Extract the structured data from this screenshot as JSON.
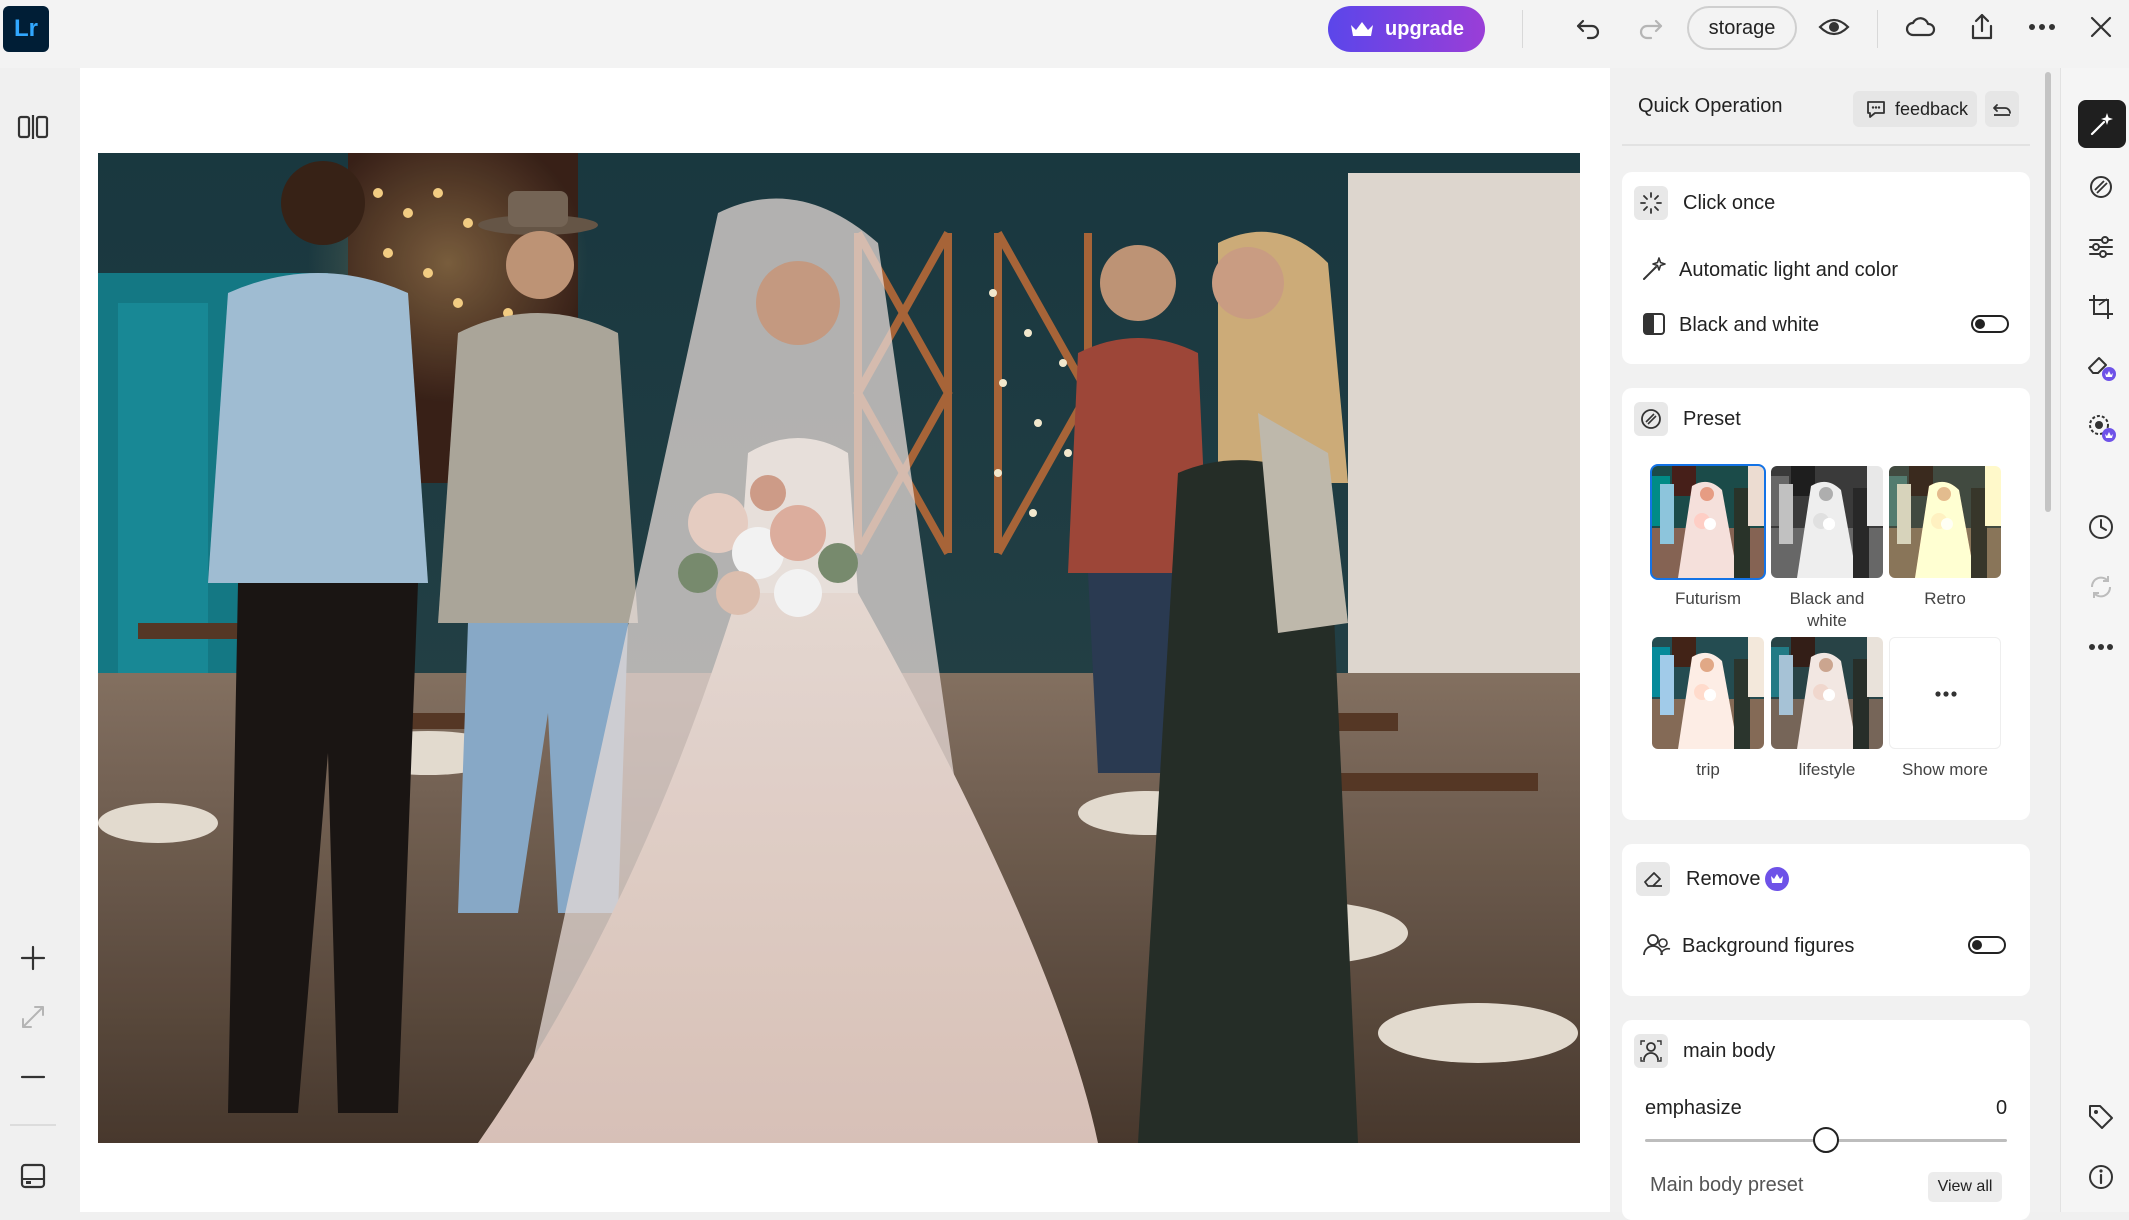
{
  "app": {
    "logo_text": "Lr"
  },
  "topbar": {
    "upgrade_label": "upgrade",
    "storage_label": "storage"
  },
  "panel": {
    "title": "Quick Operation",
    "feedback_label": "feedback",
    "click_once": {
      "title": "Click once",
      "auto_label": "Automatic light and color",
      "bw_label": "Black and white",
      "bw_on": false
    },
    "preset": {
      "title": "Preset",
      "items": [
        {
          "label": "Futurism",
          "style": "futurism"
        },
        {
          "label": "Black and white",
          "style": "bw"
        },
        {
          "label": "Retro",
          "style": "retro"
        },
        {
          "label": "trip",
          "style": "trip"
        },
        {
          "label": "lifestyle",
          "style": "lifestyle"
        },
        {
          "label": "Show more",
          "style": "more"
        }
      ],
      "selected": "Futurism"
    },
    "remove": {
      "title": "Remove",
      "background_label": "Background figures",
      "background_on": false
    },
    "main_body": {
      "title": "main body",
      "emphasize_label": "emphasize",
      "emphasize_value": "0",
      "preset_label": "Main body preset",
      "view_all_label": "View all"
    }
  },
  "colors": {
    "accent": "#1473e6",
    "upgrade_start": "#5b46ea",
    "upgrade_end": "#9a3ed7",
    "premium_badge": "#6e52e8"
  }
}
